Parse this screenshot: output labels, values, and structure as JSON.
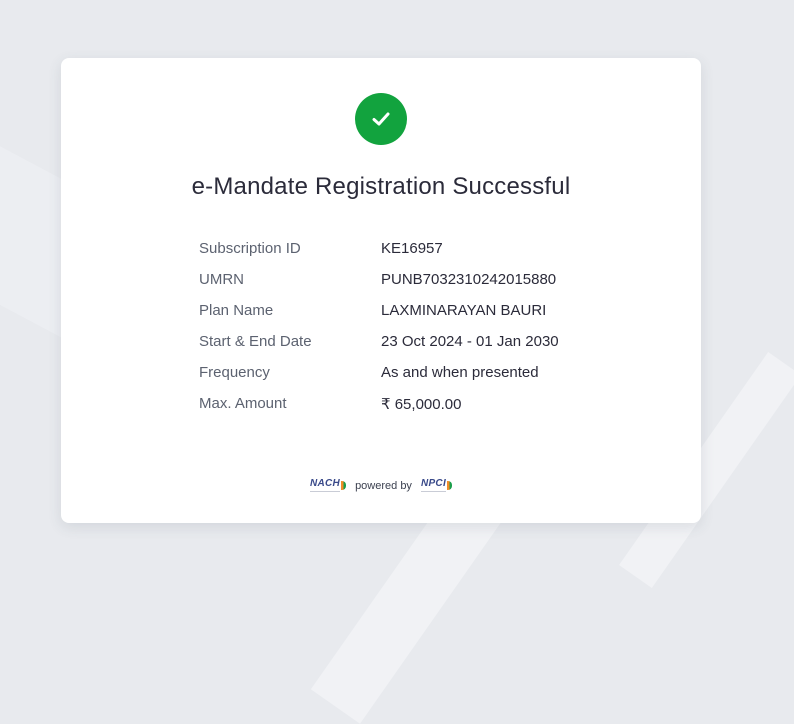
{
  "title": "e-Mandate Registration Successful",
  "details": [
    {
      "label": "Subscription ID",
      "value": "KE16957"
    },
    {
      "label": "UMRN",
      "value": "PUNB7032310242015880"
    },
    {
      "label": "Plan Name",
      "value": "LAXMINARAYAN BAURI"
    },
    {
      "label": "Start & End Date",
      "value": "23 Oct 2024 - 01 Jan 2030"
    },
    {
      "label": "Frequency",
      "value": "As and when presented"
    },
    {
      "label": "Max. Amount",
      "value": "₹ 65,000.00"
    }
  ],
  "footer": {
    "left_logo": "NACH",
    "powered_by": "powered by",
    "right_logo": "NPCI"
  },
  "colors": {
    "success": "#12a33e",
    "text": "#2b2b3a",
    "label": "#5c6270"
  },
  "icons": {
    "status": "check-icon"
  }
}
